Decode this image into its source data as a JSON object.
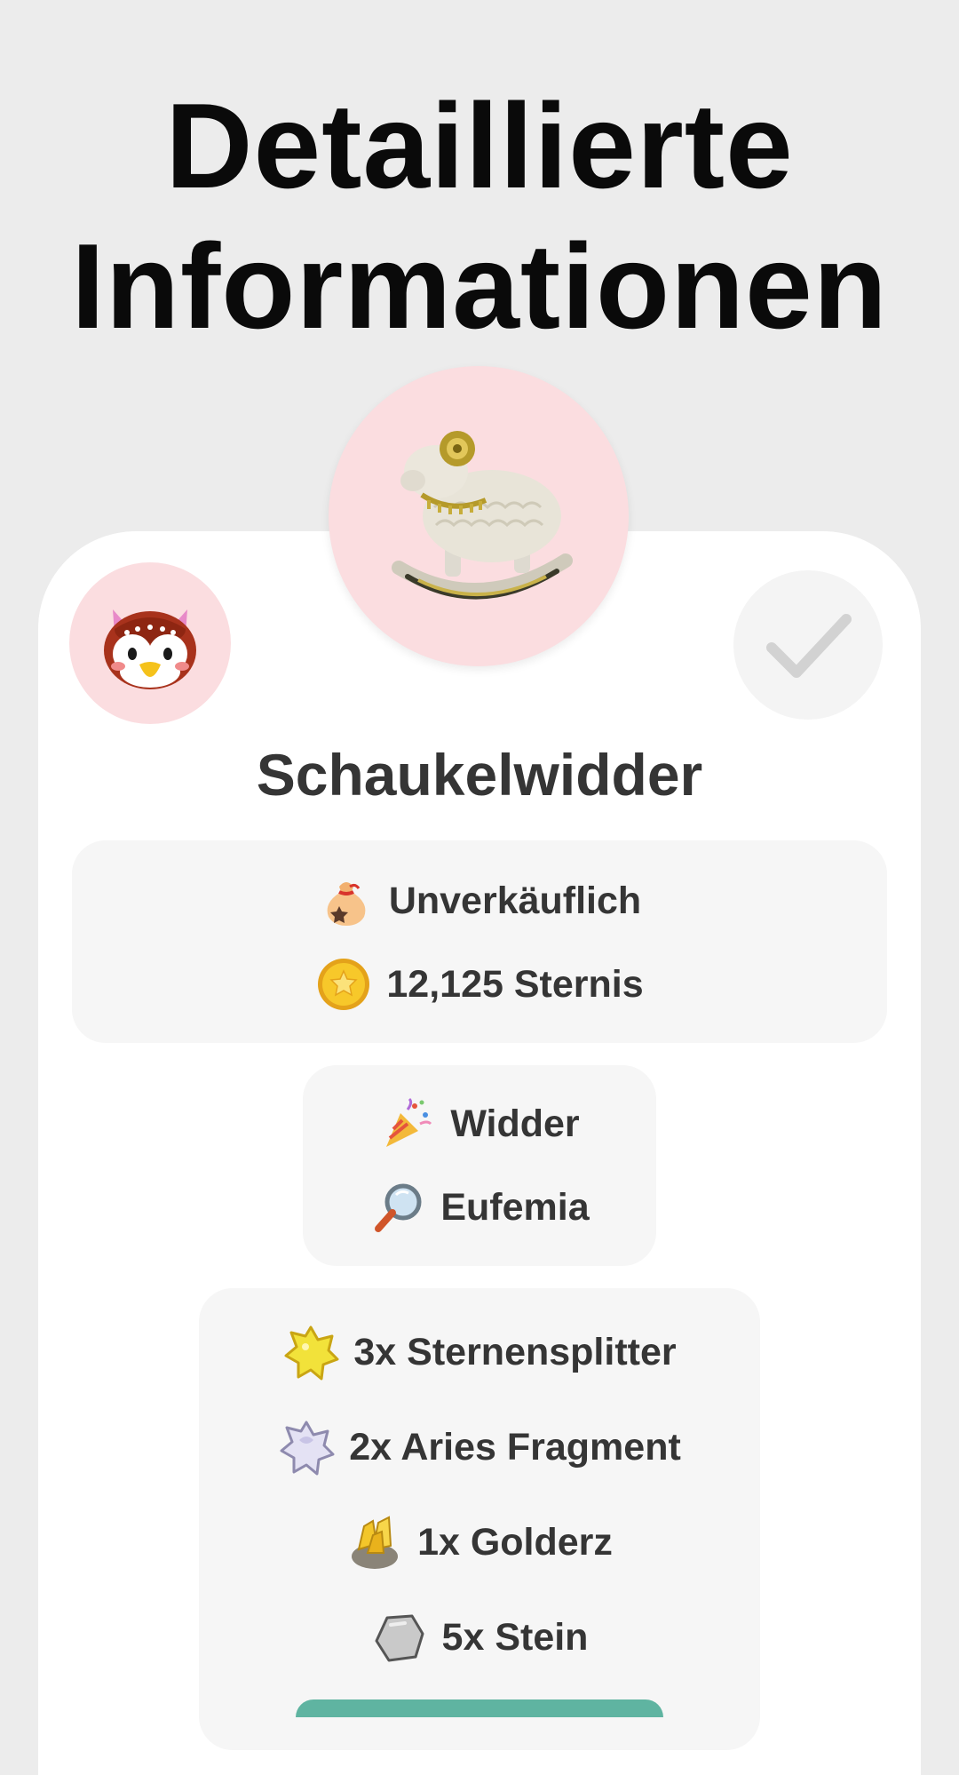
{
  "header": {
    "line1": "Detaillierte",
    "line2": "Informationen"
  },
  "item": {
    "name": "Schaukelwidder",
    "image_icon": "rocking-ram-icon",
    "villager_icon": "owl-villager-icon"
  },
  "price_box": {
    "sell": "Unverkäuflich",
    "buy": "12,125 Sternis"
  },
  "source_box": {
    "category": "Widder",
    "source": "Eufemia"
  },
  "materials": [
    {
      "label": "3x Sternensplitter",
      "icon": "star-fragment-icon"
    },
    {
      "label": "2x Aries Fragment",
      "icon": "aries-fragment-icon"
    },
    {
      "label": "1x Golderz",
      "icon": "gold-nugget-icon"
    },
    {
      "label": "5x Stein",
      "icon": "stone-icon"
    }
  ],
  "colors": {
    "background": "#ececec",
    "card": "#ffffff",
    "avatar_bg": "#fbdde0",
    "box_bg": "#f6f6f6",
    "accent": "#5fb4a1"
  }
}
